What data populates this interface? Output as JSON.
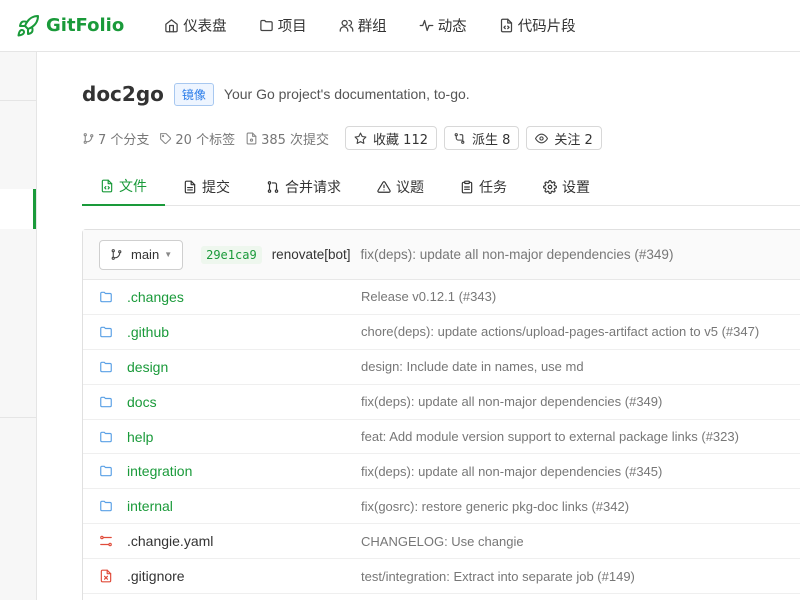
{
  "app": {
    "brand": "GitFolio"
  },
  "nav": [
    {
      "label": "仪表盘",
      "icon": "home-icon"
    },
    {
      "label": "项目",
      "icon": "folder-icon"
    },
    {
      "label": "群组",
      "icon": "users-icon"
    },
    {
      "label": "动态",
      "icon": "pulse-icon"
    },
    {
      "label": "代码片段",
      "icon": "code-file-icon"
    }
  ],
  "repo": {
    "name": "doc2go",
    "badge": "镜像",
    "description": "Your Go project's documentation, to-go."
  },
  "stats": {
    "branches": "7 个分支",
    "tags": "20 个标签",
    "commits": "385 次提交",
    "star_label": "收藏 112",
    "fork_label": "派生 8",
    "watch_label": "关注 2"
  },
  "tabs": [
    {
      "label": "文件",
      "icon": "file-code-icon",
      "active": true
    },
    {
      "label": "提交",
      "icon": "commit-list-icon",
      "active": false
    },
    {
      "label": "合并请求",
      "icon": "merge-icon",
      "active": false
    },
    {
      "label": "议题",
      "icon": "alert-icon",
      "active": false
    },
    {
      "label": "任务",
      "icon": "clipboard-icon",
      "active": false
    },
    {
      "label": "设置",
      "icon": "gear-icon",
      "active": false
    }
  ],
  "latest_commit": {
    "branch": "main",
    "sha": "29e1ca9",
    "author": "renovate[bot]",
    "message": "fix(deps): update all non-major dependencies (#349)"
  },
  "files": [
    {
      "name": ".changes",
      "type": "dir",
      "message": "Release v0.12.1 (#343)"
    },
    {
      "name": ".github",
      "type": "dir",
      "message": "chore(deps): update actions/upload-pages-artifact action to v5 (#347)"
    },
    {
      "name": "design",
      "type": "dir",
      "message": "design: Include date in names, use md"
    },
    {
      "name": "docs",
      "type": "dir",
      "message": "fix(deps): update all non-major dependencies (#349)"
    },
    {
      "name": "help",
      "type": "dir",
      "message": "feat: Add module version support to external package links (#323)"
    },
    {
      "name": "integration",
      "type": "dir",
      "message": "fix(deps): update all non-major dependencies (#345)"
    },
    {
      "name": "internal",
      "type": "dir",
      "message": "fix(gosrc): restore generic pkg-doc links (#342)"
    },
    {
      "name": ".changie.yaml",
      "type": "config",
      "message": "CHANGELOG: Use changie"
    },
    {
      "name": ".gitignore",
      "type": "ignore",
      "message": "test/integration: Extract into separate job (#149)"
    }
  ],
  "colors": {
    "accent": "#1a9a3a",
    "folder": "#5aa0e6",
    "config": "#e04b3a"
  }
}
